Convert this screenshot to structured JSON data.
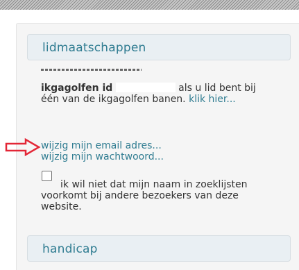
{
  "memberships": {
    "title": "lidmaatschappen",
    "id_label": "ikgagolfen id",
    "id_text": "als u lid bent bij één van de ikgagolfen banen.",
    "click_here_link": "klik hier...",
    "change_email_link": "wijzig mijn email adres...",
    "change_password_link": "wijzig mijn wachtwoord...",
    "checkbox_label": "ik wil niet dat mijn naam in zoeklijsten voorkomt bij andere bezoekers van deze website.",
    "checkbox_checked": false
  },
  "handicap": {
    "title": "handicap"
  },
  "annotation": {
    "icon": "red-arrow-icon",
    "color": "#e32636"
  },
  "colors": {
    "link": "#2f7c91",
    "header_bg": "#e9eff3",
    "panel_bg": "#f5f5f5"
  }
}
